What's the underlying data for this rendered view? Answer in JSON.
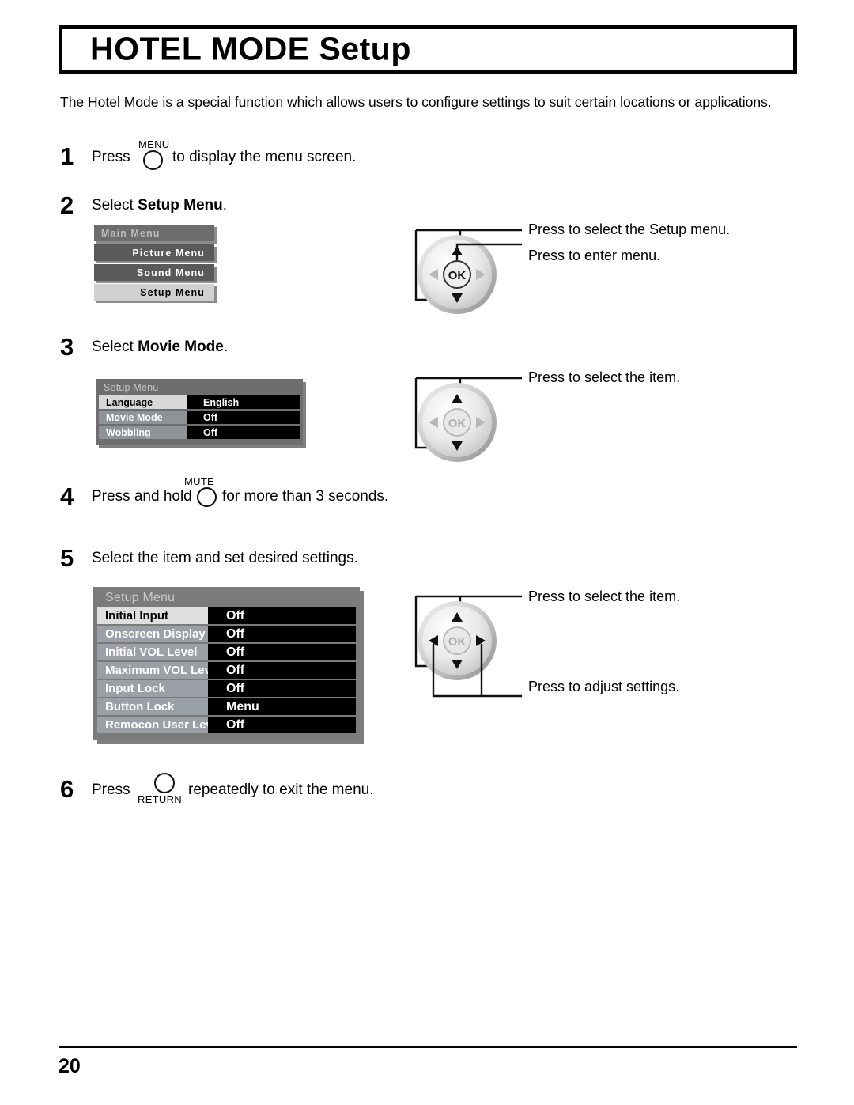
{
  "page": {
    "title": "HOTEL MODE Setup",
    "intro": "The Hotel Mode is a special function which allows users to configure settings to suit certain locations or applications.",
    "page_number": "20"
  },
  "steps": {
    "s1": {
      "number": "1",
      "text_before": "Press",
      "button_label": "MENU",
      "text_after": "to display the menu screen."
    },
    "s2": {
      "number": "2",
      "text_before": "Select ",
      "text_bold": "Setup Menu",
      "text_after": "."
    },
    "s3": {
      "number": "3",
      "text_before": "Select ",
      "text_bold": "Movie Mode",
      "text_after": "."
    },
    "s4": {
      "number": "4",
      "text_before": "Press and hold",
      "button_label": "MUTE",
      "text_after": "for more than 3 seconds."
    },
    "s5": {
      "number": "5",
      "text": "Select the item and set desired settings."
    },
    "s6": {
      "number": "6",
      "text_before": "Press",
      "button_label": "RETURN",
      "text_after": "repeatedly to exit the menu."
    }
  },
  "main_menu": {
    "header": "Main Menu",
    "items": [
      {
        "label": "Picture Menu",
        "selected": false
      },
      {
        "label": "Sound Menu",
        "selected": false
      },
      {
        "label": "Setup Menu",
        "selected": true
      }
    ]
  },
  "setup_menu_small": {
    "header": "Setup Menu",
    "rows": [
      {
        "label": "Language",
        "value": "English",
        "selected": true
      },
      {
        "label": "Movie Mode",
        "value": "Off",
        "selected": false
      },
      {
        "label": "Wobbling",
        "value": "Off",
        "selected": false
      }
    ]
  },
  "setup_menu_large": {
    "header": "Setup Menu",
    "rows": [
      {
        "label": "Initial Input",
        "value": "Off",
        "selected": true
      },
      {
        "label": "Onscreen Display",
        "value": "Off",
        "selected": false
      },
      {
        "label": "Initial VOL Level",
        "value": "Off",
        "selected": false
      },
      {
        "label": "Maximum VOL Level",
        "value": "Off",
        "selected": false
      },
      {
        "label": "Input Lock",
        "value": "Off",
        "selected": false
      },
      {
        "label": "Button Lock",
        "value": "Menu",
        "selected": false
      },
      {
        "label": "Remocon User Level",
        "value": "Off",
        "selected": false
      }
    ]
  },
  "navpads": {
    "pad1": {
      "ok_label": "OK",
      "callout_top": "Press to select the Setup menu.",
      "callout_second": "Press to enter menu."
    },
    "pad2": {
      "ok_label": "OK",
      "callout_top": "Press to select the item."
    },
    "pad3": {
      "ok_label": "OK",
      "callout_top": "Press to select the item.",
      "callout_bottom": "Press to adjust settings."
    }
  },
  "colors": {
    "osd_panel": "#7b7b7b",
    "osd_label": "#9aa0a6",
    "osd_selected": "#dedede",
    "osd_value_bg": "#000000"
  }
}
